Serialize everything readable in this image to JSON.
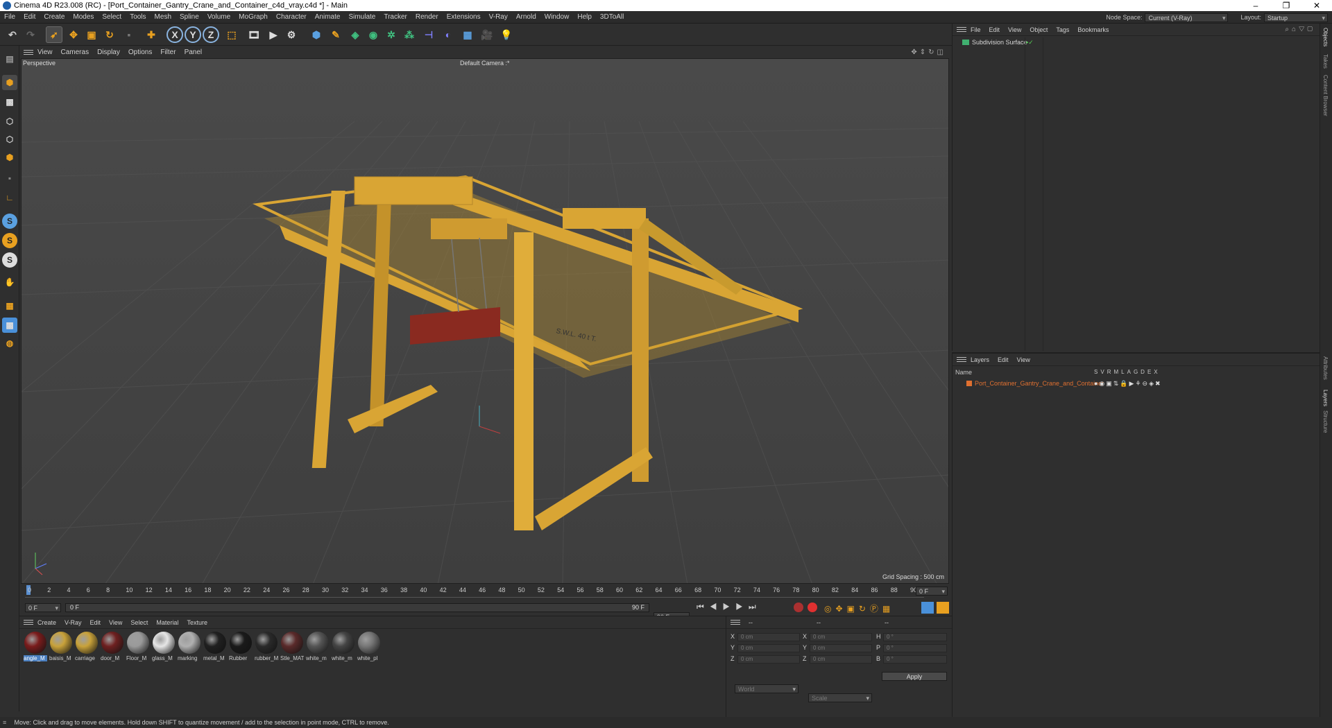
{
  "window": {
    "title": "Cinema 4D R23.008 (RC) - [Port_Container_Gantry_Crane_and_Container_c4d_vray.c4d *] - Main",
    "controls": [
      "–",
      "❐",
      "✕"
    ]
  },
  "menubar": {
    "items": [
      "File",
      "Edit",
      "Create",
      "Modes",
      "Select",
      "Tools",
      "Mesh",
      "Spline",
      "Volume",
      "MoGraph",
      "Character",
      "Animate",
      "Simulate",
      "Tracker",
      "Render",
      "Extensions",
      "V-Ray",
      "Arnold",
      "Window",
      "Help",
      "3DToAll"
    ],
    "node_space_label": "Node Space:",
    "node_space_value": "Current (V-Ray)",
    "layout_label": "Layout:",
    "layout_value": "Startup"
  },
  "toolbar": {
    "axis_x": "X",
    "axis_y": "Y",
    "axis_z": "Z"
  },
  "left_tools": {
    "s1": "S",
    "s2": "S",
    "s3": "S"
  },
  "viewport": {
    "menu": [
      "View",
      "Cameras",
      "Display",
      "Options",
      "Filter",
      "Panel"
    ],
    "name": "Perspective",
    "camera": "Default Camera :*",
    "grid_spacing": "Grid Spacing : 500 cm",
    "crane_label": "S.W.L. 40 t T."
  },
  "timeline": {
    "ticks": [
      "0",
      "2",
      "4",
      "6",
      "8",
      "10",
      "12",
      "14",
      "16",
      "18",
      "20",
      "22",
      "24",
      "26",
      "28",
      "30",
      "32",
      "34",
      "36",
      "38",
      "40",
      "42",
      "44",
      "46",
      "48",
      "50",
      "52",
      "54",
      "56",
      "58",
      "60",
      "62",
      "64",
      "66",
      "68",
      "70",
      "72",
      "74",
      "76",
      "78",
      "80",
      "82",
      "84",
      "86",
      "88",
      "90"
    ],
    "current_frame_right": "0 F",
    "start_frame": "0 F",
    "range_start": "0 F",
    "range_end": "90 F",
    "end_frame": "90 F"
  },
  "materials": {
    "menu": [
      "Create",
      "V-Ray",
      "Edit",
      "View",
      "Select",
      "Material",
      "Texture"
    ],
    "items": [
      {
        "label": "angle_M",
        "color": "#7a1c1c"
      },
      {
        "label": "baisis_M",
        "color": "#c9a23a"
      },
      {
        "label": "carriage",
        "color": "#c9a23a"
      },
      {
        "label": "door_M",
        "color": "#6e2020"
      },
      {
        "label": "Floor_M",
        "color": "#9a9a9a"
      },
      {
        "label": "glass_M",
        "color": "#e6e6e6"
      },
      {
        "label": "marking",
        "color": "#b0b0b0"
      },
      {
        "label": "metal_M",
        "color": "#202020"
      },
      {
        "label": "Rubber",
        "color": "#1a1a1a"
      },
      {
        "label": "rubber_M",
        "color": "#2a2a2a"
      },
      {
        "label": "Stle_MAT",
        "color": "#5a2a2a"
      },
      {
        "label": "white_m",
        "color": "#555555"
      },
      {
        "label": "white_m",
        "color": "#444444"
      },
      {
        "label": "white_pl",
        "color": "#777777"
      }
    ]
  },
  "coords": {
    "header": [
      "--",
      "--",
      "--"
    ],
    "x": "X",
    "y": "Y",
    "z": "Z",
    "h": "H",
    "p": "P",
    "b": "B",
    "pos_x": "0 cm",
    "pos_y": "0 cm",
    "pos_z": "0 cm",
    "size_x": "0 cm",
    "size_y": "0 cm",
    "size_z": "0 cm",
    "rot_h": "0 °",
    "rot_p": "0 °",
    "rot_b": "0 °",
    "mode1": "World",
    "mode2": "Scale",
    "apply": "Apply"
  },
  "objects": {
    "menu": [
      "File",
      "Edit",
      "View",
      "Object",
      "Tags",
      "Bookmarks"
    ],
    "row": "Subdivision Surface"
  },
  "layers": {
    "menu": [
      "Layers",
      "Edit",
      "View"
    ],
    "col_name": "Name",
    "cols": [
      "S",
      "V",
      "R",
      "M",
      "L",
      "A",
      "G",
      "D",
      "E",
      "X"
    ],
    "row": "Port_Container_Gantry_Crane_and_Container",
    "row_color": "#e07030"
  },
  "side_tabs": [
    "Objects",
    "Takes",
    "Content Browser",
    "Attributes",
    "Layers",
    "Structure"
  ],
  "status": "Move: Click and drag to move elements. Hold down SHIFT to quantize movement / add to the selection in point mode, CTRL to remove.",
  "colors": {
    "accent": "#4a90d9",
    "crane": "#d9a534",
    "container": "#8a2a20"
  }
}
